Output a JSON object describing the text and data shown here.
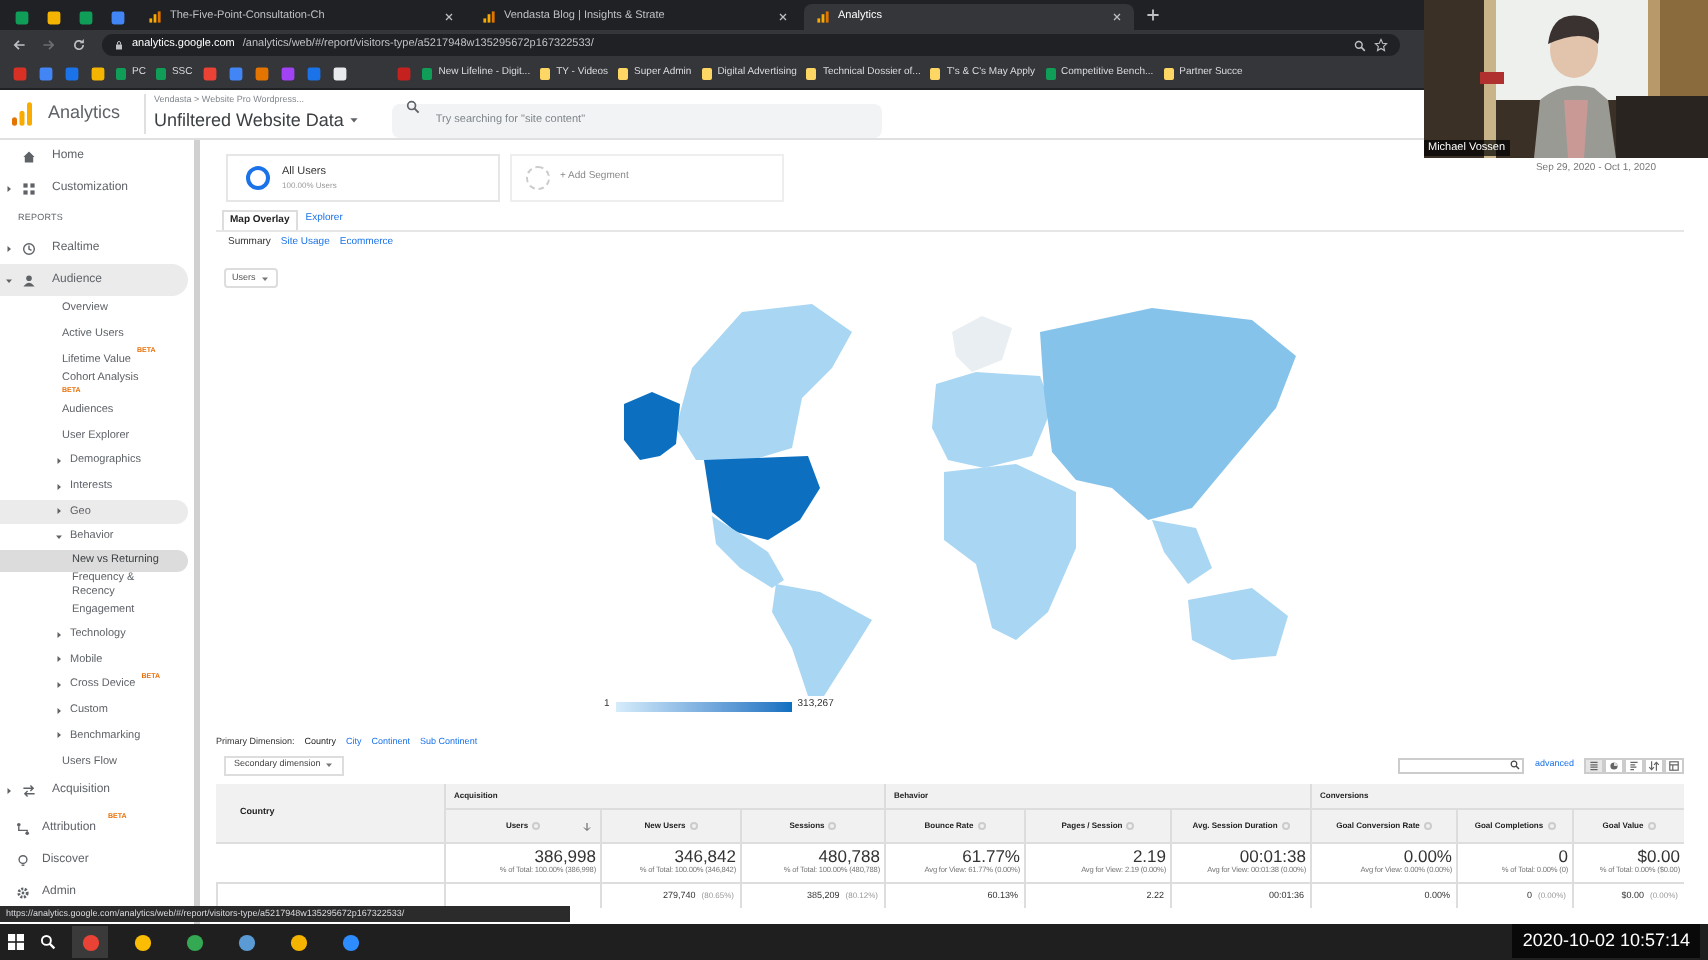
{
  "browser": {
    "tabs": [
      {
        "title": "The-Five-Point-Consultation-Ch",
        "selected": false
      },
      {
        "title": "Vendasta Blog | Insights & Strate",
        "selected": false
      },
      {
        "title": "Analytics",
        "selected": true
      }
    ],
    "url_domain": "analytics.google.com",
    "url_path": "/analytics/web/#/report/visitors-type/a5217948w135295672p167322533/",
    "bookmarks": [
      {
        "label": "PC"
      },
      {
        "label": "SSC"
      },
      {
        "label": "New Lifeline - Digit..."
      },
      {
        "label": "TY - Videos"
      },
      {
        "label": "Super Admin"
      },
      {
        "label": "Digital Advertising"
      },
      {
        "label": "Technical Dossier of..."
      },
      {
        "label": "T's & C's May Apply"
      },
      {
        "label": "Competitive Bench..."
      },
      {
        "label": "Partner Succe"
      }
    ],
    "status_url": "https://analytics.google.com/analytics/web/#/report/visitors-type/a5217948w135295672p167322533/"
  },
  "header": {
    "product": "Analytics",
    "breadcrumb": "Vendasta > Website Pro Wordpress...",
    "view": "Unfiltered Website Data",
    "search": {
      "placeholder": "Try searching for \"site content\""
    },
    "date_range": "Sep 29, 2020 - Oct 1, 2020"
  },
  "sidebar": {
    "items": [
      {
        "label": "Home"
      },
      {
        "label": "Customization",
        "expanded": false
      },
      {
        "kind": "heading",
        "label": "REPORTS"
      },
      {
        "label": "Realtime",
        "expanded": false
      },
      {
        "label": "Audience",
        "expanded": true,
        "children": [
          {
            "label": "Overview",
            "hovered": false
          },
          {
            "label": "Active Users",
            "hovered": false
          },
          {
            "label": "Lifetime Value",
            "badge": "BETA",
            "hovered": false
          },
          {
            "label": "Cohort Analysis",
            "badge": "BETA",
            "hovered": false
          },
          {
            "label": "Audiences",
            "hovered": false
          },
          {
            "label": "User Explorer",
            "hovered": false
          },
          {
            "label": "Demographics",
            "expanded": false,
            "hovered": false
          },
          {
            "label": "Interests",
            "expanded": false,
            "hovered": false
          },
          {
            "label": "Geo",
            "expanded": false,
            "hovered": true
          },
          {
            "label": "Behavior",
            "expanded": true,
            "hovered": false,
            "children": [
              {
                "label": "New vs Returning",
                "selected": true
              },
              {
                "label": "Frequency & Recency",
                "selected": false
              },
              {
                "label": "Engagement",
                "selected": false
              }
            ]
          },
          {
            "label": "Technology",
            "expanded": false,
            "hovered": false
          },
          {
            "label": "Mobile",
            "expanded": false,
            "hovered": false
          },
          {
            "label": "Cross Device",
            "badge": "BETA",
            "expanded": false,
            "hovered": false
          },
          {
            "label": "Custom",
            "expanded": false,
            "hovered": false
          },
          {
            "label": "Benchmarking",
            "expanded": false,
            "hovered": false
          },
          {
            "label": "Users Flow",
            "hovered": false
          }
        ]
      },
      {
        "label": "Acquisition",
        "expanded": false
      }
    ],
    "footer": [
      {
        "label": "Attribution",
        "badge": "BETA"
      },
      {
        "label": "Discover"
      },
      {
        "label": "Admin"
      }
    ]
  },
  "segments": [
    {
      "label": "All Users",
      "sublabel": "100.00% Users"
    }
  ],
  "add_segment": "+ Add Segment",
  "report_tabs": [
    {
      "label": "Map Overlay",
      "selected": true
    },
    {
      "label": "Explorer",
      "selected": false
    }
  ],
  "subtabs": [
    {
      "label": "Summary",
      "selected": true
    },
    {
      "label": "Site Usage",
      "selected": false
    },
    {
      "label": "Ecommerce",
      "selected": false
    }
  ],
  "metric_dropdown": "Users",
  "map_legend": {
    "min": "1",
    "max": "313,267"
  },
  "primary_dimension": {
    "label": "Primary Dimension:",
    "options": [
      {
        "label": "Country",
        "selected": true
      },
      {
        "label": "City",
        "selected": false
      },
      {
        "label": "Continent",
        "selected": false
      },
      {
        "label": "Sub Continent",
        "selected": false
      }
    ]
  },
  "secondary_dimension": "Secondary dimension",
  "table_tools": {
    "advanced": "advanced"
  },
  "table": {
    "first_column": "Country",
    "groups": [
      {
        "label": "Acquisition",
        "columns": [
          {
            "label": "Users",
            "sorted": true
          },
          {
            "label": "New Users",
            "sorted": false
          },
          {
            "label": "Sessions",
            "sorted": false
          }
        ]
      },
      {
        "label": "Behavior",
        "columns": [
          {
            "label": "Bounce Rate",
            "sorted": false
          },
          {
            "label": "Pages / Session",
            "sorted": false
          },
          {
            "label": "Avg. Session Duration",
            "sorted": false
          }
        ]
      },
      {
        "label": "Conversions",
        "columns": [
          {
            "label": "Goal Conversion Rate",
            "sorted": false
          },
          {
            "label": "Goal Completions",
            "sorted": false
          },
          {
            "label": "Goal Value",
            "sorted": false
          }
        ]
      }
    ],
    "rows": [
      {
        "kind": "total",
        "cells": [
          {
            "value": "386,998",
            "note": "% of Total: 100.00% (386,998)"
          },
          {
            "value": "346,842",
            "note": "% of Total: 100.00% (346,842)"
          },
          {
            "value": "480,788",
            "note": "% of Total: 100.00% (480,788)"
          },
          {
            "value": "61.77%",
            "note": "Avg for View: 61.77% (0.00%)"
          },
          {
            "value": "2.19",
            "note": "Avg for View: 2.19 (0.00%)"
          },
          {
            "value": "00:01:38",
            "note": "Avg for View: 00:01:38 (0.00%)"
          },
          {
            "value": "0.00%",
            "note": "Avg for View: 0.00% (0.00%)"
          },
          {
            "value": "0",
            "note": "% of Total: 0.00% (0)"
          },
          {
            "value": "$0.00",
            "note": "% of Total: 0.00% ($0.00)"
          }
        ]
      },
      {
        "kind": "row",
        "cells": [
          {},
          {
            "value": "279,740",
            "note": "(80.65%)"
          },
          {
            "value": "385,209",
            "note": "(80.12%)"
          },
          {
            "value": "60.13%"
          },
          {
            "value": "2.22"
          },
          {
            "value": "00:01:36"
          },
          {
            "value": "0.00%"
          },
          {
            "value": "0",
            "note": "(0.00%)"
          },
          {
            "value": "$0.00",
            "note": "(0.00%)"
          }
        ]
      }
    ]
  },
  "webcam": {
    "name": "Michael Vossen"
  },
  "recording_timestamp": "2020-10-02 10:57:14"
}
